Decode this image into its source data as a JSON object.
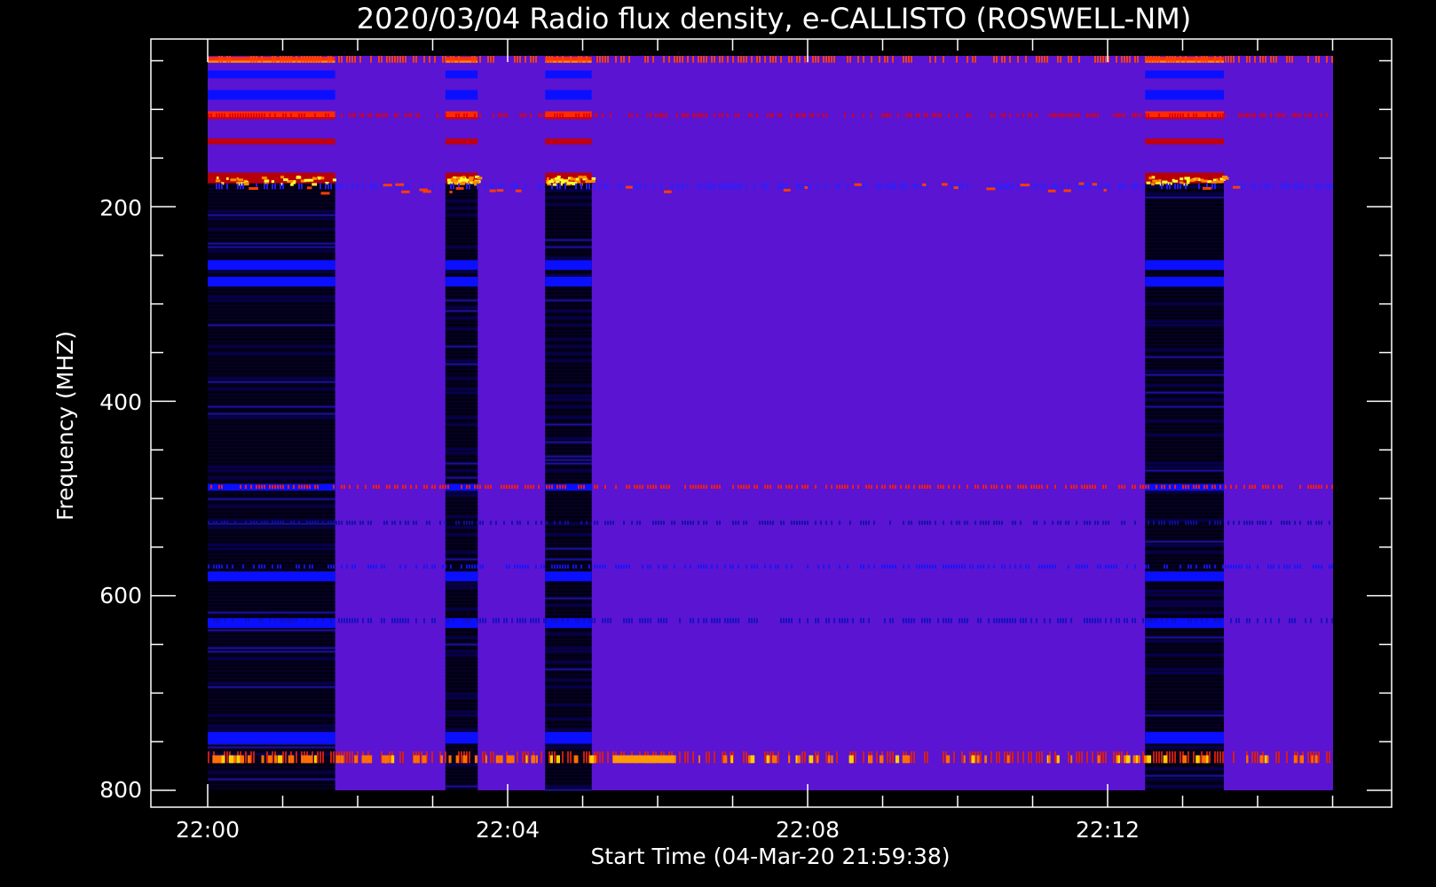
{
  "chart_data": {
    "type": "heatmap",
    "title": "2020/03/04  Radio flux density, e-CALLISTO (ROSWELL-NM)",
    "xlabel": "Start Time (04-Mar-20 21:59:38)",
    "ylabel": "Frequency (MHZ)",
    "x_tick_labels": [
      "22:00",
      "22:04",
      "22:08",
      "22:12"
    ],
    "y_tick_labels": [
      "200",
      "400",
      "600",
      "800"
    ],
    "y_ticks": [
      200,
      400,
      600,
      800
    ],
    "ylim": [
      820,
      30
    ],
    "y_inverted": true,
    "data_frequency_range_mhz": [
      45,
      800
    ],
    "colormap": [
      "#000000",
      "#0000ff",
      "#5a14d2",
      "#ff0000",
      "#ffff00"
    ],
    "background_color": "#000000",
    "dark_segments_minutes": [
      [
        0.0,
        1.7
      ],
      [
        3.17,
        3.6
      ],
      [
        4.5,
        5.12
      ],
      [
        12.5,
        13.55
      ]
    ],
    "bright_bands_mhz": [
      50,
      105,
      180,
      485,
      525,
      570,
      625,
      770
    ]
  }
}
